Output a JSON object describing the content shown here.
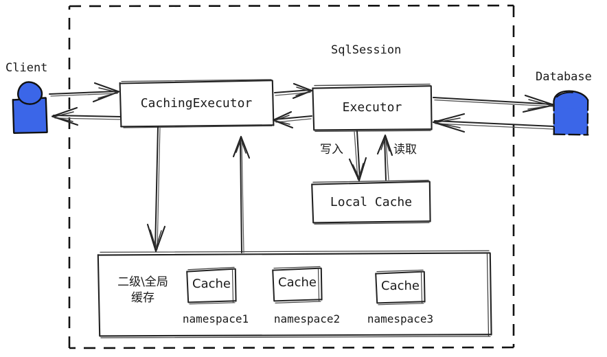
{
  "diagram": {
    "title_inner": "SqlSession",
    "actors": {
      "client": {
        "label": "Client",
        "icon": "person-icon",
        "color": "#3b66e8"
      },
      "database": {
        "label": "Database",
        "icon": "database-cylinder-icon",
        "color": "#3b66e8"
      }
    },
    "boxes": {
      "caching_executor": {
        "label": "CachingExecutor"
      },
      "executor": {
        "label": "Executor"
      },
      "local_cache": {
        "label": "Local Cache"
      },
      "global_cache": {
        "label": "二级\\全局\n缓存"
      }
    },
    "cache_items": [
      {
        "label": "Cache",
        "namespace": "namespace1"
      },
      {
        "label": "Cache",
        "namespace": "namespace2"
      },
      {
        "label": "Cache",
        "namespace": "namespace3"
      }
    ],
    "edge_labels": {
      "write": "写入",
      "read": "读取"
    },
    "colors": {
      "ink": "#1a1a1a",
      "actor_fill": "#3b66e8",
      "background": "#ffffff",
      "boundary": "#111111"
    }
  }
}
